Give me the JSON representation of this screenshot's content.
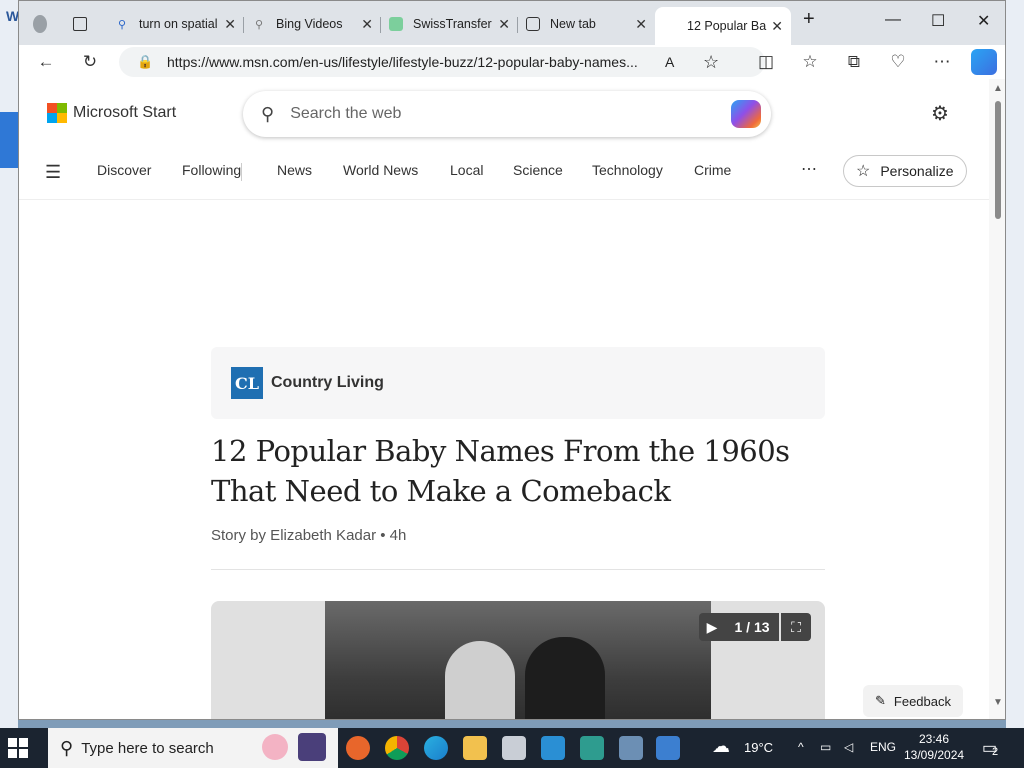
{
  "browser": {
    "tabs": [
      {
        "label": "",
        "icon": "profile-icon"
      },
      {
        "label": "",
        "icon": "tab-actions-icon"
      },
      {
        "label": "turn on spatial",
        "icon": "search-icon"
      },
      {
        "label": "Bing Videos",
        "icon": "search-icon"
      },
      {
        "label": "SwissTransfer",
        "icon": "swisstransfer-icon"
      },
      {
        "label": "New tab",
        "icon": "newtab-icon"
      },
      {
        "label": "12 Popular Ba",
        "icon": "msn-icon",
        "active": true
      }
    ],
    "address": "https://www.msn.com/en-us/lifestyle/lifestyle-buzz/12-popular-baby-names..."
  },
  "header": {
    "brand": "Microsoft Start",
    "search_placeholder": "Search the web"
  },
  "nav": {
    "items": [
      "Discover",
      "Following",
      "News",
      "World News",
      "Local",
      "Science",
      "Technology",
      "Crime"
    ],
    "personalize": "Personalize"
  },
  "article": {
    "source_logo": "CL",
    "source_name": "Country Living",
    "headline": "12 Popular Baby Names From the 1960s That Need to Make a Comeback",
    "byline": "Story by Elizabeth Kadar • 4h",
    "slide_counter": "1 / 13"
  },
  "feedback": "Feedback",
  "taskbar": {
    "search_placeholder": "Type here to search",
    "weather": "19°C",
    "language": "ENG",
    "time": "23:46",
    "date": "13/09/2024",
    "notifications": "2"
  }
}
